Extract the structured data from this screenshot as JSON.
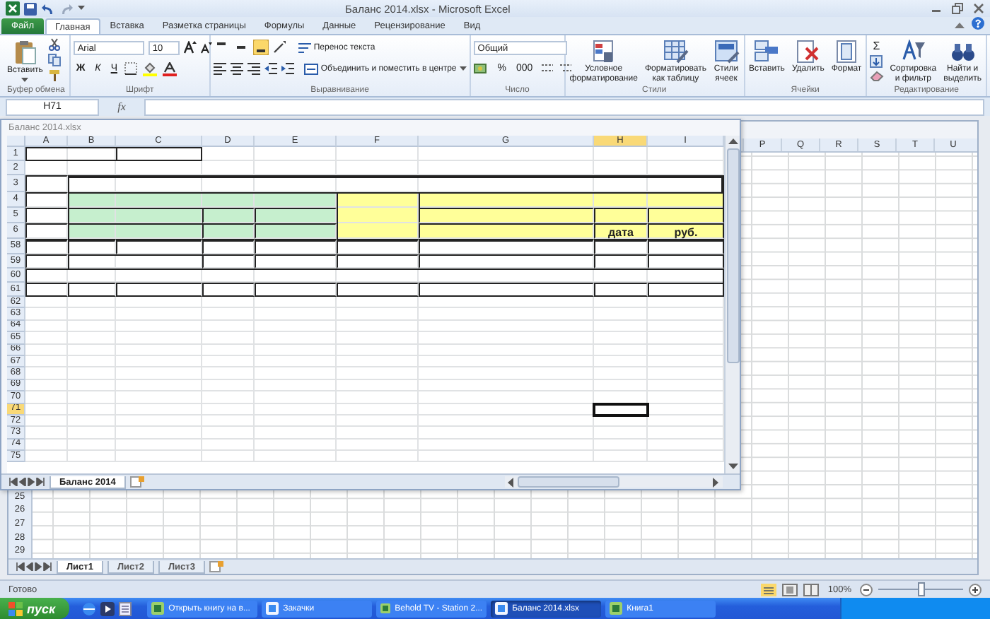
{
  "window": {
    "title": "Баланс 2014.xlsx - Microsoft Excel"
  },
  "ribbon_tabs": [
    {
      "label": "Файл",
      "kind": "file",
      "selected": false
    },
    {
      "label": "Главная",
      "kind": "tab",
      "selected": true
    },
    {
      "label": "Вставка",
      "kind": "tab",
      "selected": false
    },
    {
      "label": "Разметка страницы",
      "kind": "tab",
      "selected": false
    },
    {
      "label": "Формулы",
      "kind": "tab",
      "selected": false
    },
    {
      "label": "Данные",
      "kind": "tab",
      "selected": false
    },
    {
      "label": "Рецензирование",
      "kind": "tab",
      "selected": false
    },
    {
      "label": "Вид",
      "kind": "tab",
      "selected": false
    }
  ],
  "ribbon_groups": [
    {
      "kind": "clipboard",
      "label": "Буфер обмена",
      "paste": "Вставить"
    },
    {
      "kind": "font",
      "label": "Шрифт",
      "font_name": "Arial",
      "font_size": "10",
      "bold": "Ж",
      "italic": "К",
      "underline": "Ч"
    },
    {
      "kind": "alignment",
      "label": "Выравнивание",
      "vertical_align": [
        {
          "selected": false
        },
        {
          "selected": false
        },
        {
          "selected": true
        }
      ],
      "wrap_text": "Перенос текста",
      "merge": "Объединить и поместить в центре"
    },
    {
      "kind": "number",
      "label": "Число",
      "format": "Общий",
      "percent": "%",
      "thousands": "000"
    },
    {
      "kind": "large_buttons",
      "label": "Стили",
      "buttons": [
        {
          "label": "Условное\nформатирование",
          "kind": "conditional"
        },
        {
          "label": "Форматировать\nкак таблицу",
          "kind": "table"
        },
        {
          "label": "Стили\nячеек",
          "kind": "styles"
        }
      ]
    },
    {
      "kind": "large_buttons",
      "label": "Ячейки",
      "buttons": [
        {
          "label": "Вставить",
          "kind": "insert"
        },
        {
          "label": "Удалить",
          "kind": "delete"
        },
        {
          "label": "Формат",
          "kind": "format"
        }
      ]
    },
    {
      "kind": "editing",
      "label": "Редактирование",
      "sum": "Σ",
      "buttons": [
        {
          "label": "Сортировка\nи фильтр",
          "kind": "sort"
        },
        {
          "label": "Найти и\nвыделить",
          "kind": "find"
        }
      ]
    }
  ],
  "formula_bar": {
    "name_box": "H71",
    "function_button": "fx"
  },
  "workbook_window": {
    "title": "Баланс 2014.xlsx",
    "columns": [
      {
        "label": "A",
        "selected": false
      },
      {
        "label": "B",
        "selected": false
      },
      {
        "label": "C",
        "selected": false
      },
      {
        "label": "D",
        "selected": false
      },
      {
        "label": "E",
        "selected": false
      },
      {
        "label": "F",
        "selected": false
      },
      {
        "label": "G",
        "selected": false
      },
      {
        "label": "H",
        "selected": true
      },
      {
        "label": "I",
        "selected": false
      }
    ],
    "rows": [
      {
        "label": "1",
        "selected": false
      },
      {
        "label": "2",
        "selected": false
      },
      {
        "label": "3",
        "selected": false
      },
      {
        "label": "4",
        "selected": false
      },
      {
        "label": "5",
        "selected": false
      },
      {
        "label": "6",
        "selected": false
      },
      {
        "label": "58",
        "selected": false
      },
      {
        "label": "59",
        "selected": false
      },
      {
        "label": "60",
        "selected": false
      },
      {
        "label": "61",
        "selected": false
      },
      {
        "label": "62",
        "selected": false
      },
      {
        "label": "63",
        "selected": false
      },
      {
        "label": "64",
        "selected": false
      },
      {
        "label": "65",
        "selected": false
      },
      {
        "label": "66",
        "selected": false
      },
      {
        "label": "67",
        "selected": false
      },
      {
        "label": "68",
        "selected": false
      },
      {
        "label": "69",
        "selected": false
      },
      {
        "label": "70",
        "selected": false
      },
      {
        "label": "71",
        "selected": true
      },
      {
        "label": "72",
        "selected": false
      },
      {
        "label": "73",
        "selected": false
      },
      {
        "label": "74",
        "selected": false
      },
      {
        "label": "75",
        "selected": false
      }
    ],
    "header_cells": [
      {
        "text": "дата"
      },
      {
        "text": "руб."
      }
    ],
    "fills": [
      {
        "color": "#c6efce"
      },
      {
        "color": "#ffff99"
      }
    ],
    "sheet_tabs": [
      {
        "label": "Баланс 2014",
        "selected": true
      }
    ]
  },
  "background_sheet": {
    "columns": [
      {
        "label": "P"
      },
      {
        "label": "Q"
      },
      {
        "label": "R"
      },
      {
        "label": "S"
      },
      {
        "label": "T"
      },
      {
        "label": "U"
      }
    ],
    "rows": [
      {
        "label": "25"
      },
      {
        "label": "26"
      },
      {
        "label": "27"
      },
      {
        "label": "28"
      },
      {
        "label": "29"
      }
    ],
    "sheet_tabs": [
      {
        "label": "Лист1",
        "selected": true
      },
      {
        "label": "Лист2",
        "selected": false
      },
      {
        "label": "Лист3",
        "selected": false
      }
    ]
  },
  "status_bar": {
    "status": "Готово",
    "zoom": "100%",
    "zoom_slider": {
      "level": 0.5
    }
  },
  "taskbar": {
    "start": "пуск",
    "tasks": [
      {
        "label": "Открыть книгу на в...",
        "selected": false
      },
      {
        "label": "Закачки",
        "selected": false
      },
      {
        "label": "Behold TV - Station 2...",
        "selected": false
      },
      {
        "label": "Баланс 2014.xlsx",
        "selected": true
      },
      {
        "label": "Книга1",
        "selected": false
      }
    ]
  }
}
